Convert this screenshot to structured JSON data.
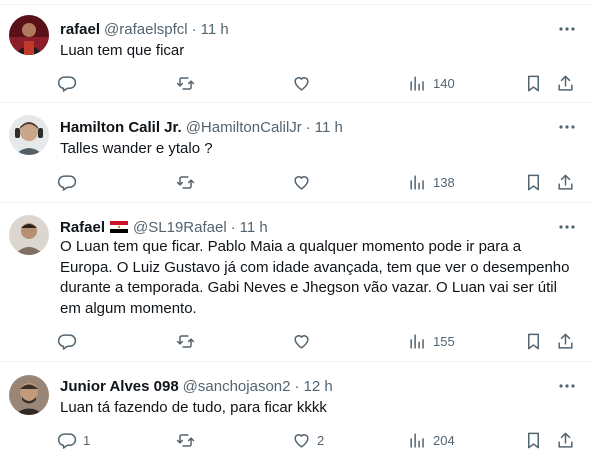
{
  "tweets": [
    {
      "name": "rafael",
      "handle": "@rafaelspfcl",
      "sep": "·",
      "time": "11 h",
      "text": "Luan tem que ficar",
      "replies": "",
      "likes": "",
      "views": "140",
      "avatar_colors": [
        "#7a1a24",
        "#2b2b2b"
      ]
    },
    {
      "name": "Hamilton Calil Jr.",
      "handle": "@HamiltonCalilJr",
      "sep": "·",
      "time": "11 h",
      "text": "Talles wander e ytalo ?",
      "replies": "",
      "likes": "",
      "views": "138",
      "avatar_colors": [
        "#cfd4d6",
        "#6b5a4a"
      ]
    },
    {
      "name": "Rafael",
      "handle": "@SL19Rafael",
      "sep": "·",
      "time": "11 h",
      "text": "O Luan tem que ficar. Pablo Maia a qualquer momento pode ir para a Europa. O Luiz Gustavo já com idade avançada, tem que ver o desempenho durante a temporada. Gabi Neves e Jhegson vão vazar. O Luan vai ser útil em algum momento.",
      "replies": "",
      "likes": "",
      "views": "155",
      "avatar_colors": [
        "#d9d2cc",
        "#8c7b6e"
      ]
    },
    {
      "name": "Junior Alves 098",
      "handle": "@sanchojason2",
      "sep": "·",
      "time": "12 h",
      "text": "Luan tá fazendo de tudo, para ficar kkkk",
      "replies": "1",
      "likes": "2",
      "views": "204",
      "avatar_colors": [
        "#8a7565",
        "#3a2e26"
      ]
    }
  ],
  "icons": {
    "reply": "reply-icon",
    "repost": "repost-icon",
    "like": "like-icon",
    "views": "views-icon",
    "bookmark": "bookmark-icon",
    "share": "share-icon",
    "more": "more-icon"
  },
  "colors": {
    "text": "#0f1419",
    "secondary": "#536471",
    "divider": "#eff3f4",
    "flag_red": "#ce1126",
    "flag_black": "#000000"
  }
}
